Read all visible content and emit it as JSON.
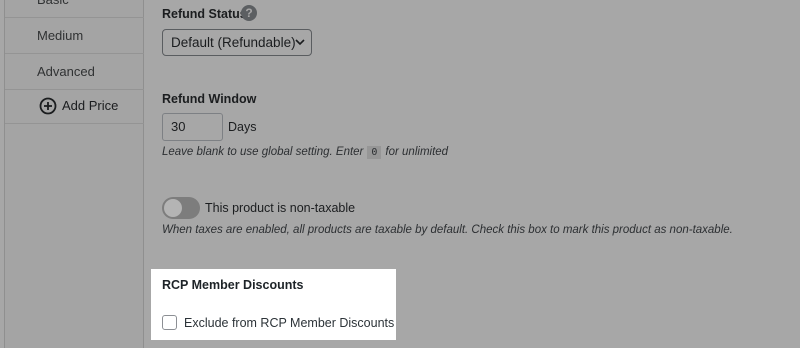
{
  "sidebar": {
    "items": [
      {
        "label": "Basic"
      },
      {
        "label": "Medium"
      },
      {
        "label": "Advanced"
      }
    ],
    "add_price_label": "Add Price",
    "add_icon": "plus-circle-icon"
  },
  "refund_status": {
    "label": "Refund Status",
    "help_icon": "question-circle-icon",
    "help_glyph": "?",
    "selected": "Default (Refundable)"
  },
  "refund_window": {
    "label": "Refund Window",
    "value": "30",
    "unit": "Days",
    "hint_before": "Leave blank to use global setting. Enter",
    "hint_code": "0",
    "hint_after": "for unlimited"
  },
  "taxable": {
    "toggle_on": false,
    "label": "This product is non-taxable",
    "description": "When taxes are enabled, all products are taxable by default. Check this box to mark this product as non-taxable."
  },
  "rcp": {
    "title": "RCP Member Discounts",
    "checkbox_checked": false,
    "checkbox_label": "Exclude from RCP Member Discounts"
  }
}
